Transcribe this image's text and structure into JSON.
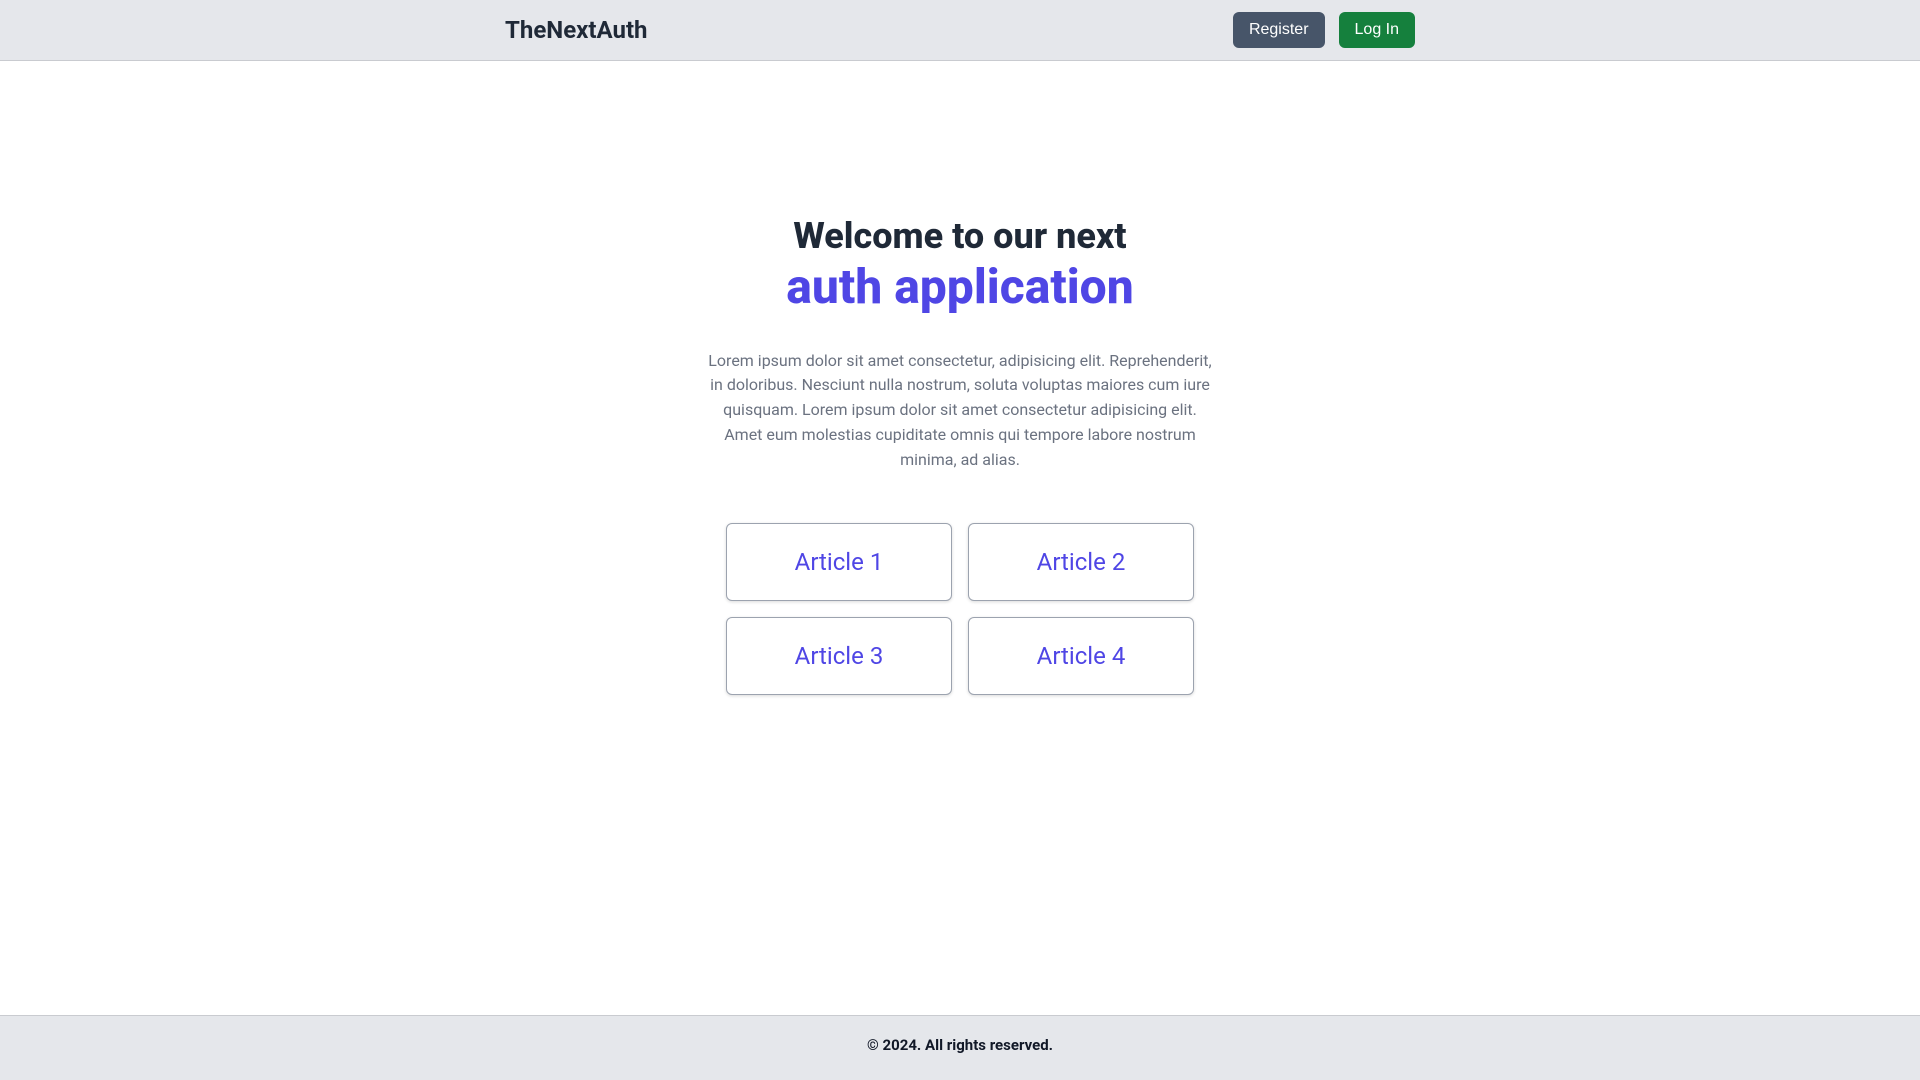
{
  "header": {
    "brand": "TheNextAuth",
    "register_label": "Register",
    "login_label": "Log In"
  },
  "hero": {
    "title_line1": "Welcome to our next",
    "title_line2": "auth application",
    "description": "Lorem ipsum dolor sit amet consectetur, adipisicing elit. Reprehenderit, in doloribus. Nesciunt nulla nostrum, soluta voluptas maiores cum iure quisquam. Lorem ipsum dolor sit amet consectetur adipisicing elit. Amet eum molestias cupiditate omnis qui tempore labore nostrum minima, ad alias."
  },
  "articles": [
    {
      "label": "Article 1"
    },
    {
      "label": "Article 2"
    },
    {
      "label": "Article 3"
    },
    {
      "label": "Article 4"
    }
  ],
  "footer": {
    "text": "© 2024. All rights reserved."
  }
}
